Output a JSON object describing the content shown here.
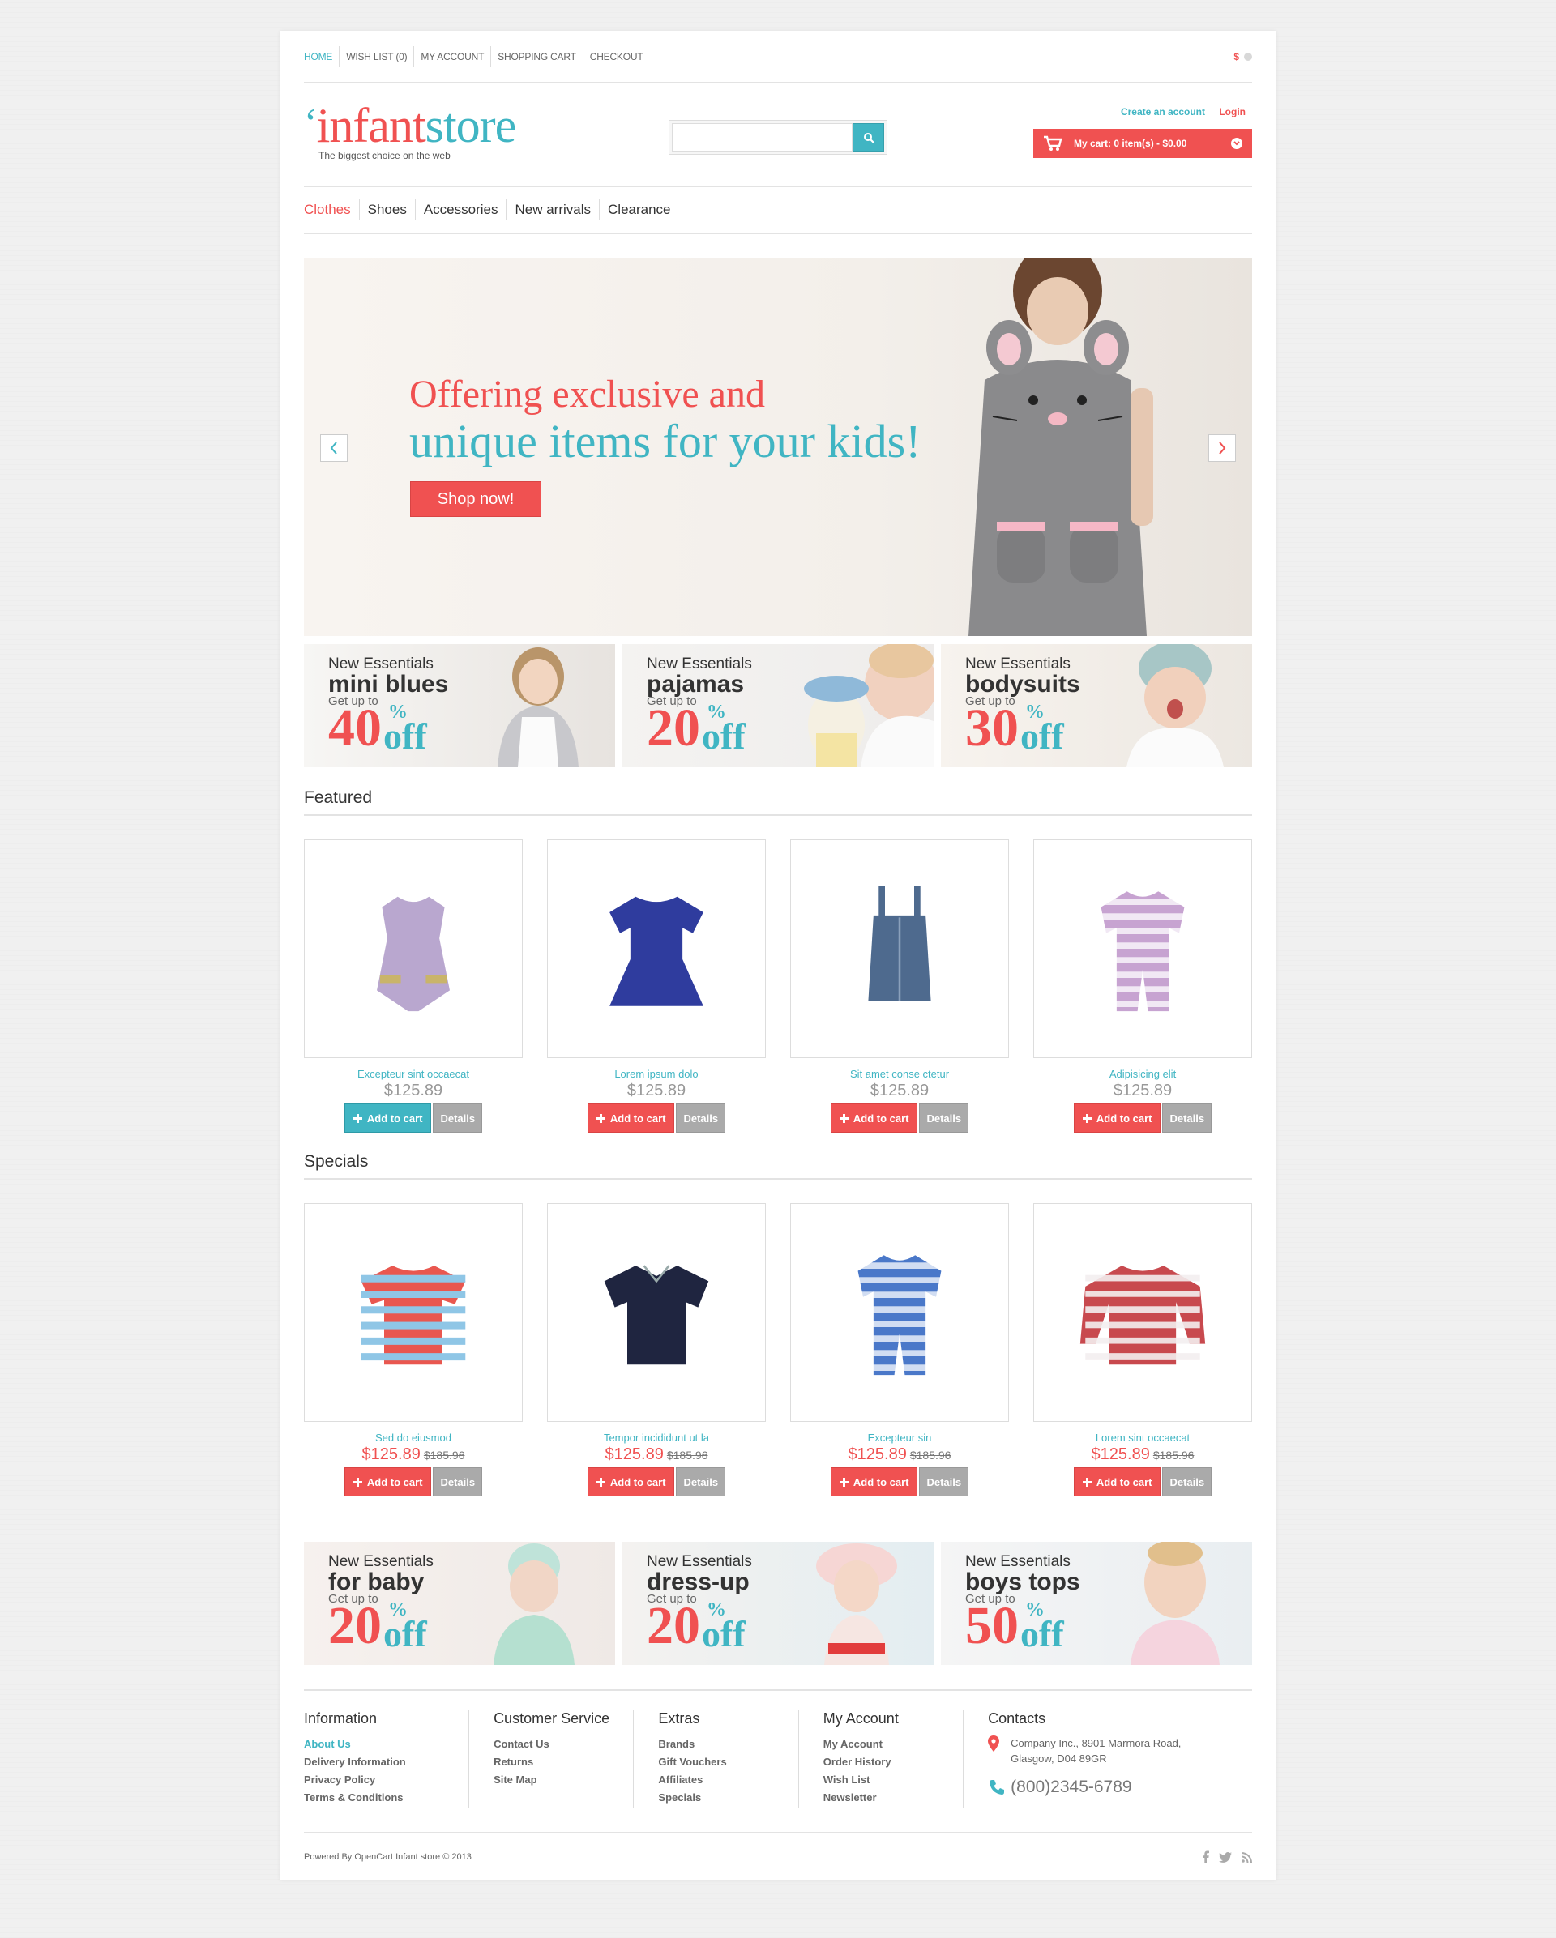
{
  "top_links": [
    "HOME",
    "WISH LIST (0)",
    "MY ACCOUNT",
    "SHOPPING CART",
    "CHECKOUT"
  ],
  "currency": "$",
  "logo": {
    "quote": "‘",
    "part1": "infant",
    "part2": "store",
    "tagline": "The biggest choice on the web"
  },
  "search": {
    "value": "",
    "placeholder": ""
  },
  "account": {
    "create": "Create an account",
    "login": "Login"
  },
  "cart": {
    "label": "My cart:  0 item(s) - $0.00"
  },
  "nav": [
    "Clothes",
    "Shoes",
    "Accessories",
    "New arrivals",
    "Clearance"
  ],
  "slider": {
    "line1": "Offering exclusive and",
    "line2": "unique items for your kids!",
    "button": "Shop now!"
  },
  "banners_top": [
    {
      "kicker": "New Essentials",
      "category": "mini blues",
      "getup": "Get up to",
      "percent": "40",
      "pct_sign": "%",
      "off": "off"
    },
    {
      "kicker": "New Essentials",
      "category": "pajamas",
      "getup": "Get up to",
      "percent": "20",
      "pct_sign": "%",
      "off": "off"
    },
    {
      "kicker": "New Essentials",
      "category": "bodysuits",
      "getup": "Get up to",
      "percent": "30",
      "pct_sign": "%",
      "off": "off"
    }
  ],
  "featured": {
    "title": "Featured",
    "products": [
      {
        "name": "Excepteur sint occaecat",
        "price": "$125.89",
        "add": "Add to cart",
        "details": "Details",
        "color": "#b9a7cf"
      },
      {
        "name": "Lorem ipsum dolo",
        "price": "$125.89",
        "add": "Add to cart",
        "details": "Details",
        "color": "#2f3c9e"
      },
      {
        "name": "Sit amet conse ctetur",
        "price": "$125.89",
        "add": "Add to cart",
        "details": "Details",
        "color": "#4e6a8e"
      },
      {
        "name": "Adipisicing elit",
        "price": "$125.89",
        "add": "Add to cart",
        "details": "Details",
        "color": "#c7a3d1"
      }
    ]
  },
  "specials": {
    "title": "Specials",
    "products": [
      {
        "name": "Sed do eiusmod",
        "price": "$125.89",
        "old_price": "$185.96",
        "add": "Add to cart",
        "details": "Details",
        "color": "#e9574f"
      },
      {
        "name": "Tempor incididunt ut la",
        "price": "$125.89",
        "old_price": "$185.96",
        "add": "Add to cart",
        "details": "Details",
        "color": "#1f2540"
      },
      {
        "name": "Excepteur sin",
        "price": "$125.89",
        "old_price": "$185.96",
        "add": "Add to cart",
        "details": "Details",
        "color": "#4a78c9"
      },
      {
        "name": "Lorem sint occaecat",
        "price": "$125.89",
        "old_price": "$185.96",
        "add": "Add to cart",
        "details": "Details",
        "color": "#c8494e"
      }
    ]
  },
  "banners_bottom": [
    {
      "kicker": "New Essentials",
      "category": "for baby",
      "getup": "Get up to",
      "percent": "20",
      "pct_sign": "%",
      "off": "off"
    },
    {
      "kicker": "New Essentials",
      "category": "dress-up",
      "getup": "Get up to",
      "percent": "20",
      "pct_sign": "%",
      "off": "off"
    },
    {
      "kicker": "New Essentials",
      "category": "boys tops",
      "getup": "Get up to",
      "percent": "50",
      "pct_sign": "%",
      "off": "off"
    }
  ],
  "footer": {
    "columns": [
      {
        "title": "Information",
        "links": [
          "About Us",
          "Delivery Information",
          "Privacy Policy",
          "Terms & Conditions"
        ]
      },
      {
        "title": "Customer Service",
        "links": [
          "Contact Us",
          "Returns",
          "Site Map"
        ]
      },
      {
        "title": "Extras",
        "links": [
          "Brands",
          "Gift Vouchers",
          "Affiliates",
          "Specials"
        ]
      },
      {
        "title": "My Account",
        "links": [
          "My Account",
          "Order History",
          "Wish List",
          "Newsletter"
        ]
      }
    ],
    "contacts": {
      "title": "Contacts",
      "address_line1": "Company Inc., 8901 Marmora Road,",
      "address_line2": "Glasgow, D04 89GR",
      "phone": "(800)2345-6789"
    },
    "powered": "Powered By OpenCart Infant store © 2013",
    "social": [
      "facebook-icon",
      "twitter-icon",
      "rss-icon"
    ]
  },
  "colors": {
    "accent_red": "#f05151",
    "accent_teal": "#40b5c3"
  }
}
